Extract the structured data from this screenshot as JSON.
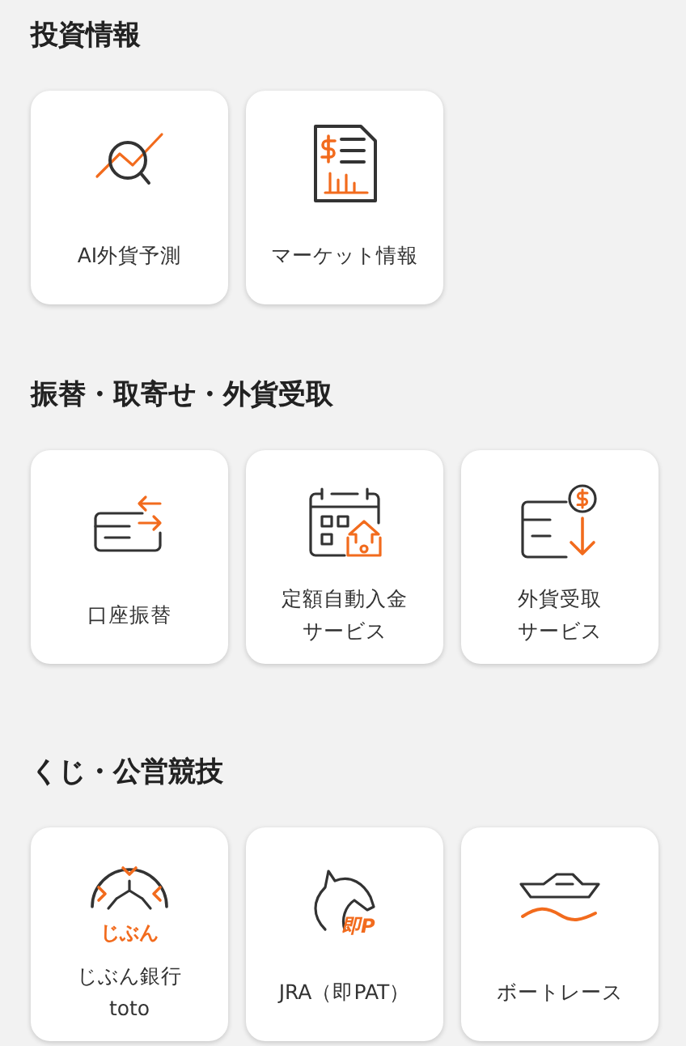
{
  "sections": [
    {
      "title": "投資情報",
      "cards": [
        {
          "kind": "forecast",
          "label": [
            "AI外貨予測"
          ]
        },
        {
          "kind": "report",
          "label": [
            "マーケット情報"
          ]
        }
      ]
    },
    {
      "title": "振替・取寄せ・外貨受取",
      "cards": [
        {
          "kind": "transfer",
          "label": [
            "口座振替"
          ]
        },
        {
          "kind": "calendar",
          "label": [
            "定額自動入金",
            "サービス"
          ]
        },
        {
          "kind": "receive",
          "label": [
            "外貨受取",
            "サービス"
          ]
        }
      ]
    },
    {
      "title": "くじ・公営競技",
      "cards": [
        {
          "kind": "toto",
          "logo_text": "じぶん",
          "label": [
            "じぶん銀行",
            "toto"
          ]
        },
        {
          "kind": "horse",
          "logo_text": "即P",
          "label": [
            "JRA（即PAT）"
          ]
        },
        {
          "kind": "boat",
          "label": [
            "ボートレース"
          ]
        }
      ]
    }
  ]
}
